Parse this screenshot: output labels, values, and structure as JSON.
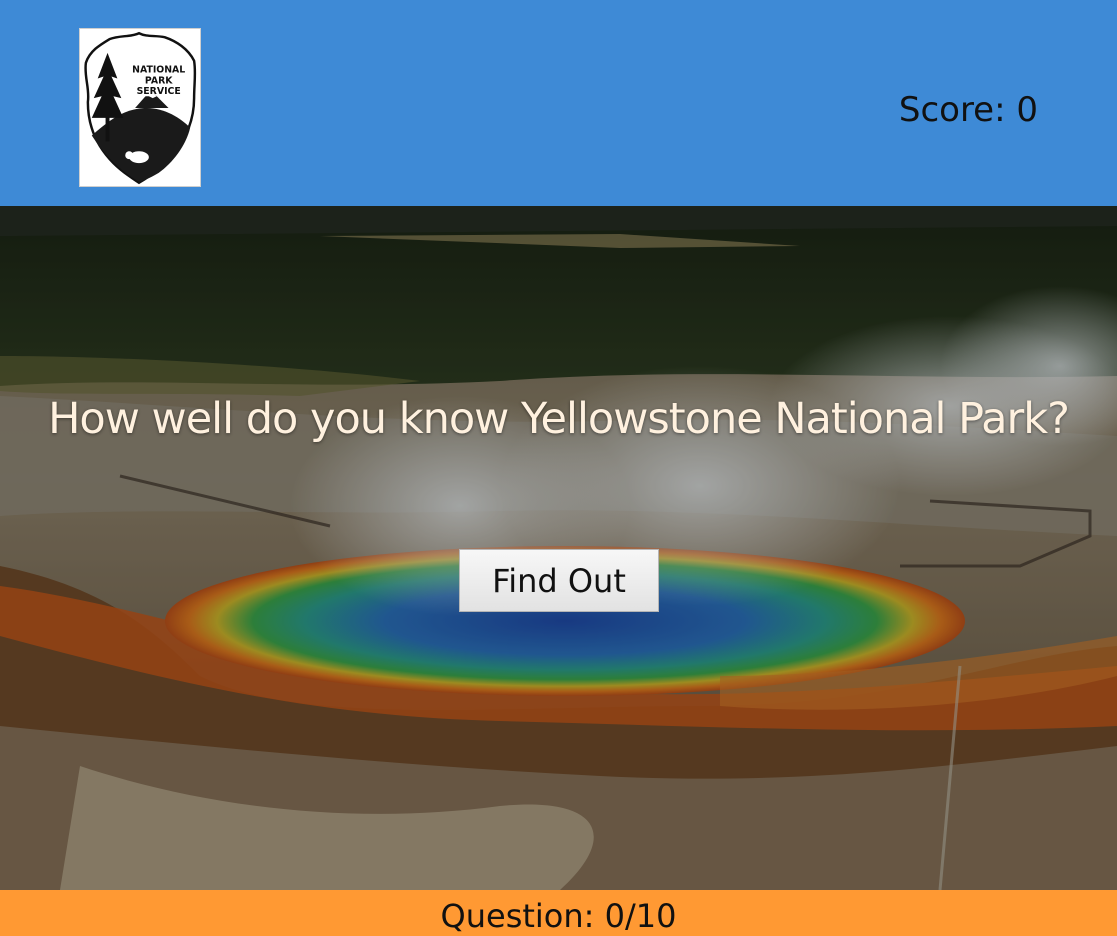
{
  "header": {
    "logo_text": [
      "NATIONAL",
      "PARK",
      "SERVICE"
    ],
    "score_label": "Score: 0",
    "background_color": "#3e8ad6"
  },
  "hero": {
    "title": "How well do you know Yellowstone National Park?",
    "button_label": "Find Out"
  },
  "footer": {
    "question_counter": "Question: 0/10",
    "background_color": "#ff9933"
  }
}
